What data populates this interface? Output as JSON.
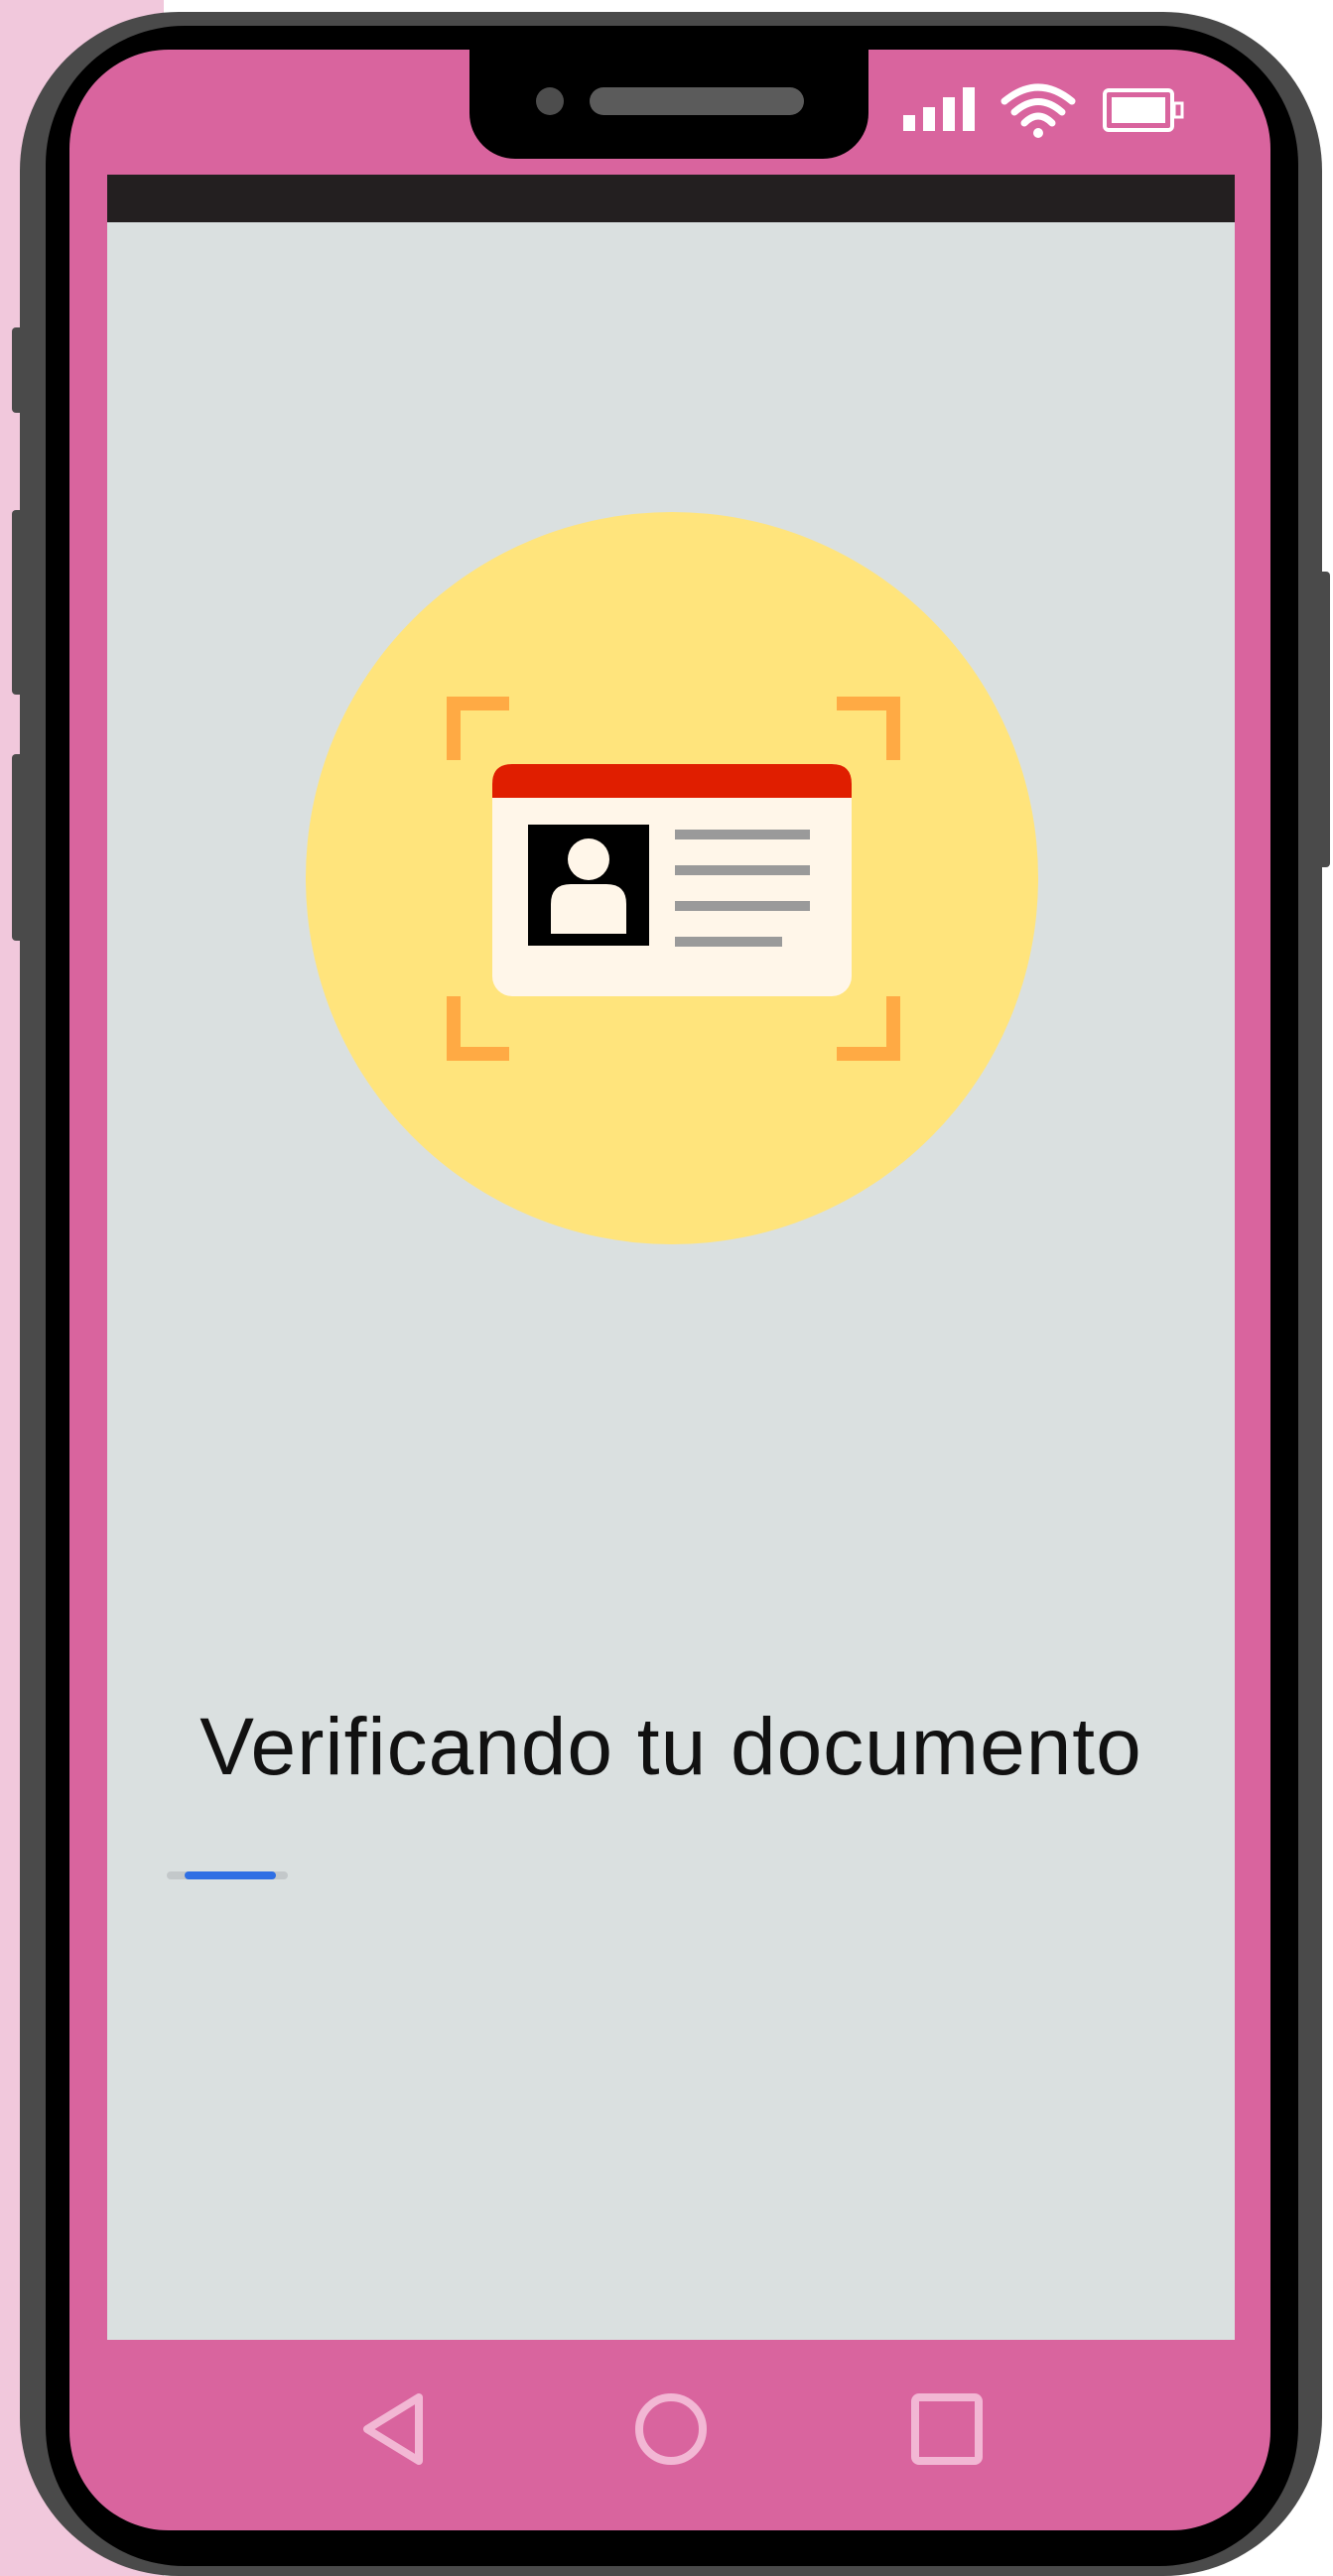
{
  "screen": {
    "title": "Verificando tu documento",
    "progress": {
      "value": 0.45,
      "state": "indeterminate"
    },
    "illustration": {
      "subject": "id-card-scan",
      "icons": [
        "id-card-icon",
        "person-icon",
        "scan-frame-icon"
      ]
    }
  },
  "status_bar": {
    "icons": [
      "signal-icon",
      "wifi-icon",
      "battery-icon"
    ]
  },
  "navigation_bar": {
    "buttons": [
      "back-button",
      "home-button",
      "recents-button"
    ]
  },
  "colors": {
    "device_face": "#d9649e",
    "screen_background": "#dae0e0",
    "app_bar": "#231f20",
    "circle": "#ffe47c",
    "card_header": "#e01e00",
    "scan_corners": "#ffaa44",
    "progress": "#2f6fe4"
  }
}
